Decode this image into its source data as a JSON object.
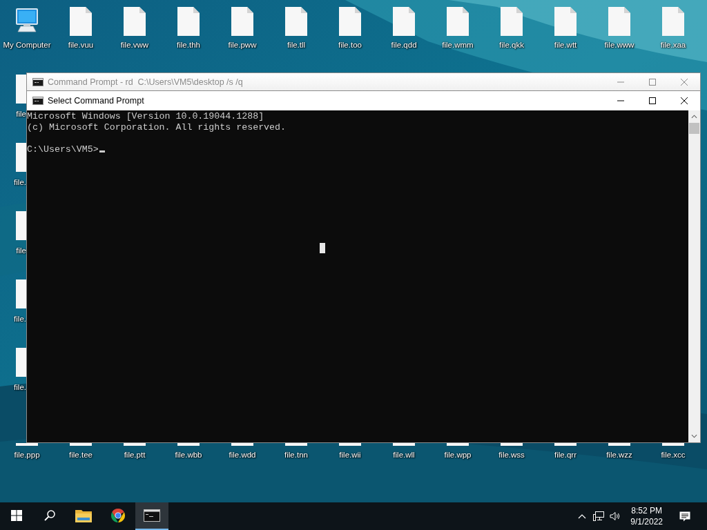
{
  "desktop": {
    "top_row": [
      {
        "kind": "computer",
        "label": "My Computer"
      },
      {
        "kind": "file",
        "label": "file.vuu"
      },
      {
        "kind": "file",
        "label": "file.vww"
      },
      {
        "kind": "file",
        "label": "file.thh"
      },
      {
        "kind": "file",
        "label": "file.pww"
      },
      {
        "kind": "file",
        "label": "file.tll"
      },
      {
        "kind": "file",
        "label": "file.too"
      },
      {
        "kind": "file",
        "label": "file.qdd"
      },
      {
        "kind": "file",
        "label": "file.wmm"
      },
      {
        "kind": "file",
        "label": "file.qkk"
      },
      {
        "kind": "file",
        "label": "file.wtt"
      },
      {
        "kind": "file",
        "label": "file.www"
      },
      {
        "kind": "file",
        "label": "file.xaa"
      }
    ],
    "left_column": [
      {
        "label": "file"
      },
      {
        "label": "file."
      },
      {
        "label": "file"
      },
      {
        "label": "file."
      },
      {
        "label": "file."
      }
    ],
    "bottom_row": [
      {
        "label": "file.ppp"
      },
      {
        "label": "file.tee"
      },
      {
        "label": "file.ptt"
      },
      {
        "label": "file.wbb"
      },
      {
        "label": "file.wdd"
      },
      {
        "label": "file.tnn"
      },
      {
        "label": "file.wii"
      },
      {
        "label": "file.wll"
      },
      {
        "label": "file.wpp"
      },
      {
        "label": "file.wss"
      },
      {
        "label": "file.qrr"
      },
      {
        "label": "file.wzz"
      },
      {
        "label": "file.xcc"
      }
    ]
  },
  "windows": [
    {
      "title": "Command Prompt - rd  C:\\Users\\VM5\\desktop /s /q",
      "active": false
    },
    {
      "title": "Select Command Prompt",
      "active": true,
      "console": {
        "output": [
          "Microsoft Windows [Version 10.0.19044.1288]",
          "(c) Microsoft Corporation. All rights reserved."
        ],
        "prompt": "C:\\Users\\VM5>"
      }
    }
  ],
  "taskbar": {
    "apps": [
      {
        "kind": "start",
        "active": false
      },
      {
        "kind": "search",
        "active": false
      },
      {
        "kind": "explorer",
        "active": false
      },
      {
        "kind": "browser",
        "active": false
      },
      {
        "kind": "terminal",
        "active": true
      }
    ],
    "time": "8:52 PM",
    "date": "9/1/2022"
  }
}
